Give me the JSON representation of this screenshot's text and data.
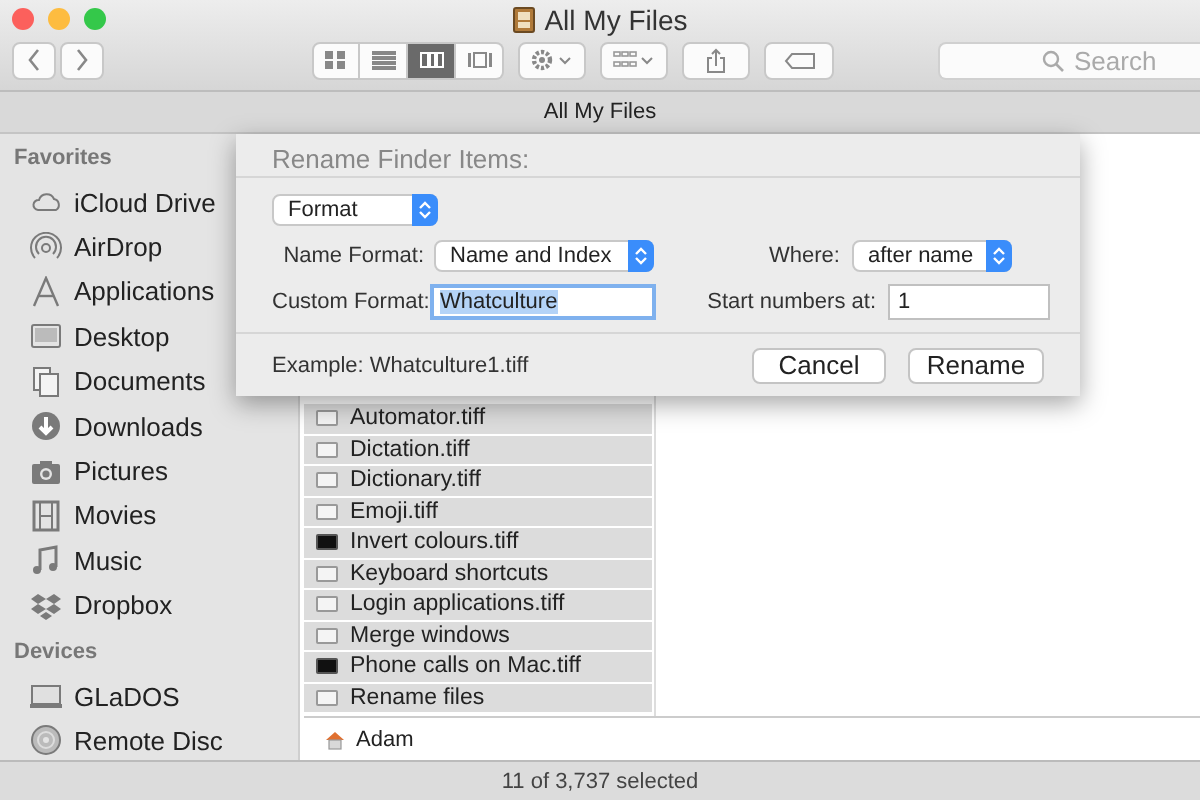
{
  "window": {
    "title": "All My Files"
  },
  "toolbar": {
    "view_buttons": [
      {
        "kind": "icons",
        "selected": false
      },
      {
        "kind": "list",
        "selected": false
      },
      {
        "kind": "columns",
        "selected": true
      },
      {
        "kind": "coverflow",
        "selected": false
      }
    ],
    "search": {
      "placeholder": "Search"
    }
  },
  "path_bar": {
    "title": "All My Files"
  },
  "sidebar": {
    "sections": [
      {
        "heading": "Favorites",
        "items": [
          {
            "label": "iCloud Drive",
            "kind": "cloud"
          },
          {
            "label": "AirDrop",
            "kind": "airdrop"
          },
          {
            "label": "Applications",
            "kind": "apps"
          },
          {
            "label": "Desktop",
            "kind": "desktop"
          },
          {
            "label": "Documents",
            "kind": "documents"
          },
          {
            "label": "Downloads",
            "kind": "downloads"
          },
          {
            "label": "Pictures",
            "kind": "camera"
          },
          {
            "label": "Movies",
            "kind": "film"
          },
          {
            "label": "Music",
            "kind": "music"
          },
          {
            "label": "Dropbox",
            "kind": "dropbox"
          }
        ]
      },
      {
        "heading": "Devices",
        "items": [
          {
            "label": "GLaDOS",
            "kind": "laptop"
          },
          {
            "label": "Remote Disc",
            "kind": "disc"
          }
        ]
      }
    ]
  },
  "file_list": {
    "rows": [
      {
        "name": "Automator.tiff",
        "kind": "light",
        "selected": true
      },
      {
        "name": "Dictation.tiff",
        "kind": "light",
        "selected": true
      },
      {
        "name": "Dictionary.tiff",
        "kind": "light",
        "selected": true
      },
      {
        "name": "Emoji.tiff",
        "kind": "light",
        "selected": true
      },
      {
        "name": "Invert colours.tiff",
        "kind": "dark",
        "selected": true
      },
      {
        "name": "Keyboard shortcuts",
        "kind": "light",
        "selected": true
      },
      {
        "name": "Login applications.tiff",
        "kind": "light",
        "selected": true
      },
      {
        "name": "Merge windows",
        "kind": "light",
        "selected": true
      },
      {
        "name": "Phone calls on Mac.tiff",
        "kind": "dark",
        "selected": true
      },
      {
        "name": "Rename files",
        "kind": "light",
        "selected": true
      }
    ]
  },
  "dialog": {
    "title": "Rename Finder Items:",
    "mode": "Format",
    "name_format_label": "Name Format:",
    "name_format": "Name and Index",
    "where_label": "Where:",
    "where": "after name",
    "custom_format_label": "Custom Format:",
    "custom_format": "Whatculture",
    "start_label": "Start numbers at:",
    "start": "1",
    "example": "Example: Whatculture1.tiff",
    "buttons": [
      "Cancel",
      "Rename"
    ]
  },
  "bottom_path": {
    "label": "Adam"
  },
  "status_bar": {
    "text": "11 of 3,737 selected"
  }
}
